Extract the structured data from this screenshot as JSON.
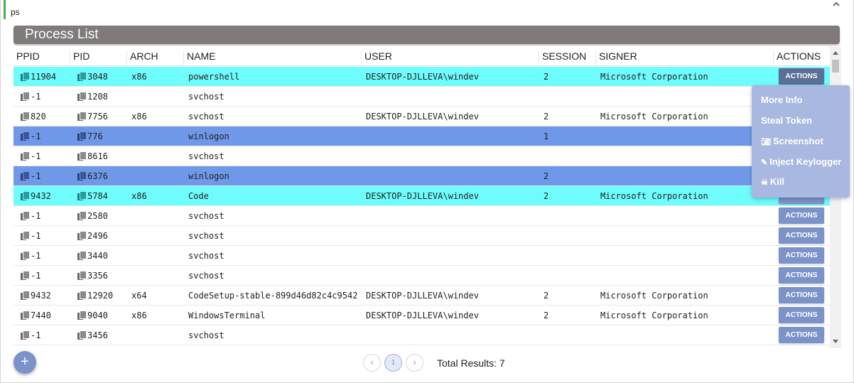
{
  "command": {
    "text": "ps"
  },
  "panel": {
    "title": "Process List"
  },
  "table": {
    "columns": [
      "PPID",
      "PID",
      "ARCH",
      "NAME",
      "USER",
      "SESSION",
      "SIGNER",
      "ACTIONS"
    ],
    "rows": [
      {
        "ppid": "11904",
        "pid": "3048",
        "arch": "x86",
        "name": "powershell",
        "user": "DESKTOP-DJLLEVA\\windev",
        "session": "2",
        "signer": "Microsoft Corporation",
        "action": "ACTIONS"
      },
      {
        "ppid": "-1",
        "pid": "1208",
        "arch": "",
        "name": "svchost",
        "user": "",
        "session": "",
        "signer": "",
        "action": ""
      },
      {
        "ppid": "820",
        "pid": "7756",
        "arch": "x86",
        "name": "svchost",
        "user": "DESKTOP-DJLLEVA\\windev",
        "session": "2",
        "signer": "Microsoft Corporation",
        "action": ""
      },
      {
        "ppid": "-1",
        "pid": "776",
        "arch": "",
        "name": "winlogon",
        "user": "",
        "session": "1",
        "signer": "",
        "action": ""
      },
      {
        "ppid": "-1",
        "pid": "8616",
        "arch": "",
        "name": "svchost",
        "user": "",
        "session": "",
        "signer": "",
        "action": ""
      },
      {
        "ppid": "-1",
        "pid": "6376",
        "arch": "",
        "name": "winlogon",
        "user": "",
        "session": "2",
        "signer": "",
        "action": ""
      },
      {
        "ppid": "9432",
        "pid": "5784",
        "arch": "x86",
        "name": "Code",
        "user": "DESKTOP-DJLLEVA\\windev",
        "session": "2",
        "signer": "Microsoft Corporation",
        "action": ""
      },
      {
        "ppid": "-1",
        "pid": "2580",
        "arch": "",
        "name": "svchost",
        "user": "",
        "session": "",
        "signer": "",
        "action": "ACTIONS"
      },
      {
        "ppid": "-1",
        "pid": "2496",
        "arch": "",
        "name": "svchost",
        "user": "",
        "session": "",
        "signer": "",
        "action": "ACTIONS"
      },
      {
        "ppid": "-1",
        "pid": "3440",
        "arch": "",
        "name": "svchost",
        "user": "",
        "session": "",
        "signer": "",
        "action": "ACTIONS"
      },
      {
        "ppid": "-1",
        "pid": "3356",
        "arch": "",
        "name": "svchost",
        "user": "",
        "session": "",
        "signer": "",
        "action": "ACTIONS"
      },
      {
        "ppid": "9432",
        "pid": "12920",
        "arch": "x64",
        "name": "CodeSetup-stable-899d46d82c4c9542",
        "user": "DESKTOP-DJLLEVA\\windev",
        "session": "2",
        "signer": "Microsoft Corporation",
        "action": "ACTIONS"
      },
      {
        "ppid": "7440",
        "pid": "9040",
        "arch": "x86",
        "name": "WindowsTerminal",
        "user": "DESKTOP-DJLLEVA\\windev",
        "session": "2",
        "signer": "Microsoft Corporation",
        "action": "ACTIONS"
      },
      {
        "ppid": "-1",
        "pid": "3456",
        "arch": "",
        "name": "svchost",
        "user": "",
        "session": "",
        "signer": "",
        "action": "ACTIONS"
      }
    ]
  },
  "actions_menu": {
    "items": [
      {
        "label": "More Info",
        "icon": ""
      },
      {
        "label": "Steal Token",
        "icon": ""
      },
      {
        "label": "Screenshot",
        "icon": "camera-icon"
      },
      {
        "label": "Inject Keylogger",
        "icon": "syringe-icon"
      },
      {
        "label": "Kill",
        "icon": "skull-icon"
      }
    ]
  },
  "pagination": {
    "prev": "‹",
    "current_page": "1",
    "next": "›",
    "total_label": "Total Results: 7"
  },
  "fab": {
    "label": "+"
  },
  "colors": {
    "highlight_cyan": "#6ffcfc",
    "highlight_blue": "#6f98e9",
    "accent": "#7b93c9",
    "header_bg": "#807a7a"
  }
}
